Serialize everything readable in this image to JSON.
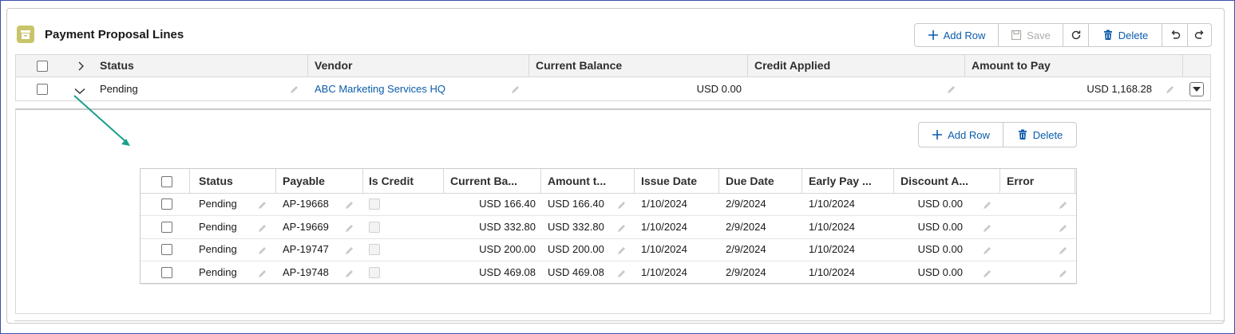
{
  "header": {
    "title": "Payment Proposal Lines",
    "add_row": "Add Row",
    "save": "Save",
    "delete": "Delete"
  },
  "columns": [
    "Status",
    "Vendor",
    "Current Balance",
    "Credit Applied",
    "Amount to Pay"
  ],
  "row": {
    "status": "Pending",
    "vendor": "ABC Marketing Services HQ",
    "current_balance": "USD 0.00",
    "credit_applied": "",
    "amount_to_pay": "USD 1,168.28"
  },
  "sub_toolbar": {
    "add_row": "Add Row",
    "delete": "Delete"
  },
  "sub_columns": [
    "Status",
    "Payable",
    "Is Credit",
    "Current Ba...",
    "Amount t...",
    "Issue Date",
    "Due Date",
    "Early Pay ...",
    "Discount A...",
    "Error"
  ],
  "sub_rows": [
    {
      "status": "Pending",
      "payable": "AP-19668",
      "current_balance": "USD 166.40",
      "amount": "USD 166.40",
      "issue_date": "1/10/2024",
      "due_date": "2/9/2024",
      "early_pay": "1/10/2024",
      "discount": "USD 0.00",
      "error": ""
    },
    {
      "status": "Pending",
      "payable": "AP-19669",
      "current_balance": "USD 332.80",
      "amount": "USD 332.80",
      "issue_date": "1/10/2024",
      "due_date": "2/9/2024",
      "early_pay": "1/10/2024",
      "discount": "USD 0.00",
      "error": ""
    },
    {
      "status": "Pending",
      "payable": "AP-19747",
      "current_balance": "USD 200.00",
      "amount": "USD 200.00",
      "issue_date": "1/10/2024",
      "due_date": "2/9/2024",
      "early_pay": "1/10/2024",
      "discount": "USD 0.00",
      "error": ""
    },
    {
      "status": "Pending",
      "payable": "AP-19748",
      "current_balance": "USD 469.08",
      "amount": "USD 469.08",
      "issue_date": "1/10/2024",
      "due_date": "2/9/2024",
      "early_pay": "1/10/2024",
      "discount": "USD 0.00",
      "error": ""
    }
  ],
  "colors": {
    "accent": "#0b5cab",
    "icon_bg": "#c9c36a",
    "arrow": "#1a9f8c"
  }
}
